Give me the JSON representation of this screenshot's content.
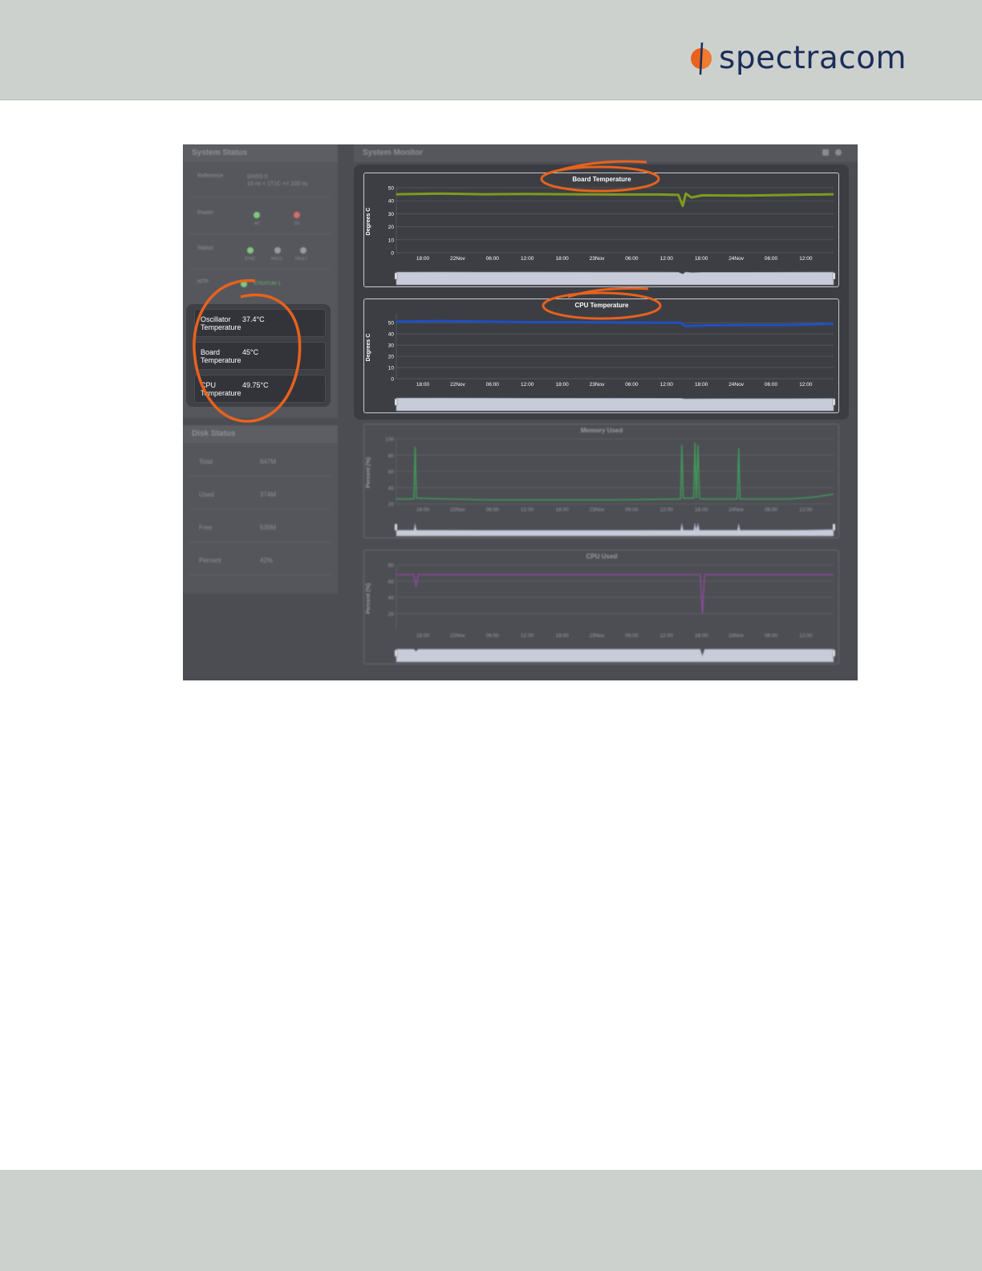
{
  "brand": {
    "name": "spectracom",
    "color": "#1c2d5a",
    "accent": "#e8621d"
  },
  "system_status": {
    "title": "System Status",
    "reference_label": "Reference",
    "reference_value": "GNSS 0",
    "reference_detail": "10 ns < 1T1C <= 100 ns",
    "power_label": "Power",
    "power_leds": [
      {
        "label": "AC",
        "color": "#7ec87e"
      },
      {
        "label": "DC",
        "color": "#d86a6a"
      }
    ],
    "status_label": "Status",
    "status_leds": [
      {
        "label": "SYNC",
        "color": "#7ec87e"
      },
      {
        "label": "HOLD",
        "color": "#9a9ba0"
      },
      {
        "label": "FAULT",
        "color": "#9a9ba0"
      }
    ],
    "ntp_label": "NTP",
    "ntp_value": "STRATUM 1",
    "ntp_color": "#7ec87e",
    "temperatures": [
      {
        "name": "Oscillator",
        "sub": "Temperature",
        "value": "37.4°C"
      },
      {
        "name": "Board",
        "sub": "Temperature",
        "value": "45°C"
      },
      {
        "name": "CPU",
        "sub": "Temperature",
        "value": "49.75°C"
      }
    ]
  },
  "disk_status": {
    "title": "Disk Status",
    "rows": [
      {
        "label": "Total",
        "value": "647M"
      },
      {
        "label": "Used",
        "value": "374M"
      },
      {
        "label": "Free",
        "value": "539M"
      },
      {
        "label": "Percent",
        "value": "42%"
      }
    ]
  },
  "system_monitor": {
    "title": "System Monitor",
    "controls": [
      "trash-icon",
      "gear-icon"
    ]
  },
  "chart_data": [
    {
      "type": "line",
      "title": "Board Temperature",
      "ylabel": "Degrees C",
      "ylim": [
        0,
        50
      ],
      "yticks": [
        0,
        10,
        20,
        30,
        40,
        50
      ],
      "xticks": [
        "18:00",
        "22Nov",
        "06:00",
        "12:00",
        "18:00",
        "23Nov",
        "06:00",
        "12:00",
        "18:00",
        "24Nov",
        "06:00",
        "12:00"
      ],
      "series": [
        {
          "color": "#7f9a1f",
          "x": [
            0,
            0.1,
            0.2,
            0.3,
            0.4,
            0.5,
            0.6,
            0.645,
            0.655,
            0.662,
            0.675,
            0.7,
            0.8,
            0.9,
            1
          ],
          "values": [
            45,
            45.5,
            45,
            45.2,
            45,
            44.8,
            44.8,
            44.5,
            36,
            45.5,
            42.5,
            44.2,
            44,
            44.5,
            45
          ]
        }
      ],
      "grid": true,
      "highlighted": true
    },
    {
      "type": "line",
      "title": "CPU Temperature",
      "ylabel": "Degrees C",
      "ylim": [
        0,
        58
      ],
      "yticks": [
        0,
        10,
        20,
        30,
        40,
        50
      ],
      "xticks": [
        "18:00",
        "22Nov",
        "06:00",
        "12:00",
        "18:00",
        "23Nov",
        "06:00",
        "12:00",
        "18:00",
        "24Nov",
        "06:00",
        "12:00"
      ],
      "series": [
        {
          "color": "#1f4fc4",
          "x": [
            0,
            0.1,
            0.2,
            0.3,
            0.4,
            0.5,
            0.6,
            0.65,
            0.66,
            0.7,
            0.8,
            0.9,
            1
          ],
          "values": [
            51,
            51.5,
            51,
            50.5,
            50.5,
            50.2,
            50,
            50,
            47,
            47.5,
            48,
            48,
            49
          ]
        }
      ],
      "grid": true,
      "highlighted": true
    },
    {
      "type": "line",
      "title": "Memory Used",
      "ylabel": "Percent (%)",
      "ylim": [
        20,
        100
      ],
      "yticks": [
        20,
        40,
        60,
        80,
        100
      ],
      "xticks": [
        "18:00",
        "22Nov",
        "06:00",
        "12:00",
        "18:00",
        "23Nov",
        "06:00",
        "12:00",
        "18:00",
        "24Nov",
        "06:00",
        "12:00"
      ],
      "series": [
        {
          "color": "#3f9a5a",
          "x": [
            0,
            0.04,
            0.043,
            0.046,
            0.2,
            0.5,
            0.65,
            0.653,
            0.656,
            0.68,
            0.683,
            0.686,
            0.69,
            0.693,
            0.7,
            0.78,
            0.783,
            0.786,
            0.9,
            0.95,
            1
          ],
          "values": [
            26,
            26,
            90,
            27,
            25,
            25,
            26,
            92,
            27,
            27,
            95,
            27,
            92,
            27,
            26,
            26,
            88,
            26,
            26,
            28,
            32
          ]
        }
      ],
      "grid": true,
      "highlighted": false
    },
    {
      "type": "line",
      "title": "CPU Used",
      "ylabel": "Percent (%)",
      "ylim": [
        0,
        80
      ],
      "yticks": [
        20,
        40,
        60,
        80
      ],
      "xticks": [
        "18:00",
        "22Nov",
        "06:00",
        "12:00",
        "18:00",
        "23Nov",
        "06:00",
        "12:00",
        "18:00",
        "24Nov",
        "06:00",
        "12:00"
      ],
      "series": [
        {
          "color": "#8a4a9a",
          "x": [
            0,
            0.04,
            0.045,
            0.05,
            0.3,
            0.6,
            0.695,
            0.7,
            0.705,
            0.8,
            1
          ],
          "values": [
            68,
            68,
            53,
            68,
            68,
            68,
            68,
            20,
            68,
            68,
            68
          ]
        }
      ],
      "grid": true,
      "highlighted": false
    }
  ]
}
